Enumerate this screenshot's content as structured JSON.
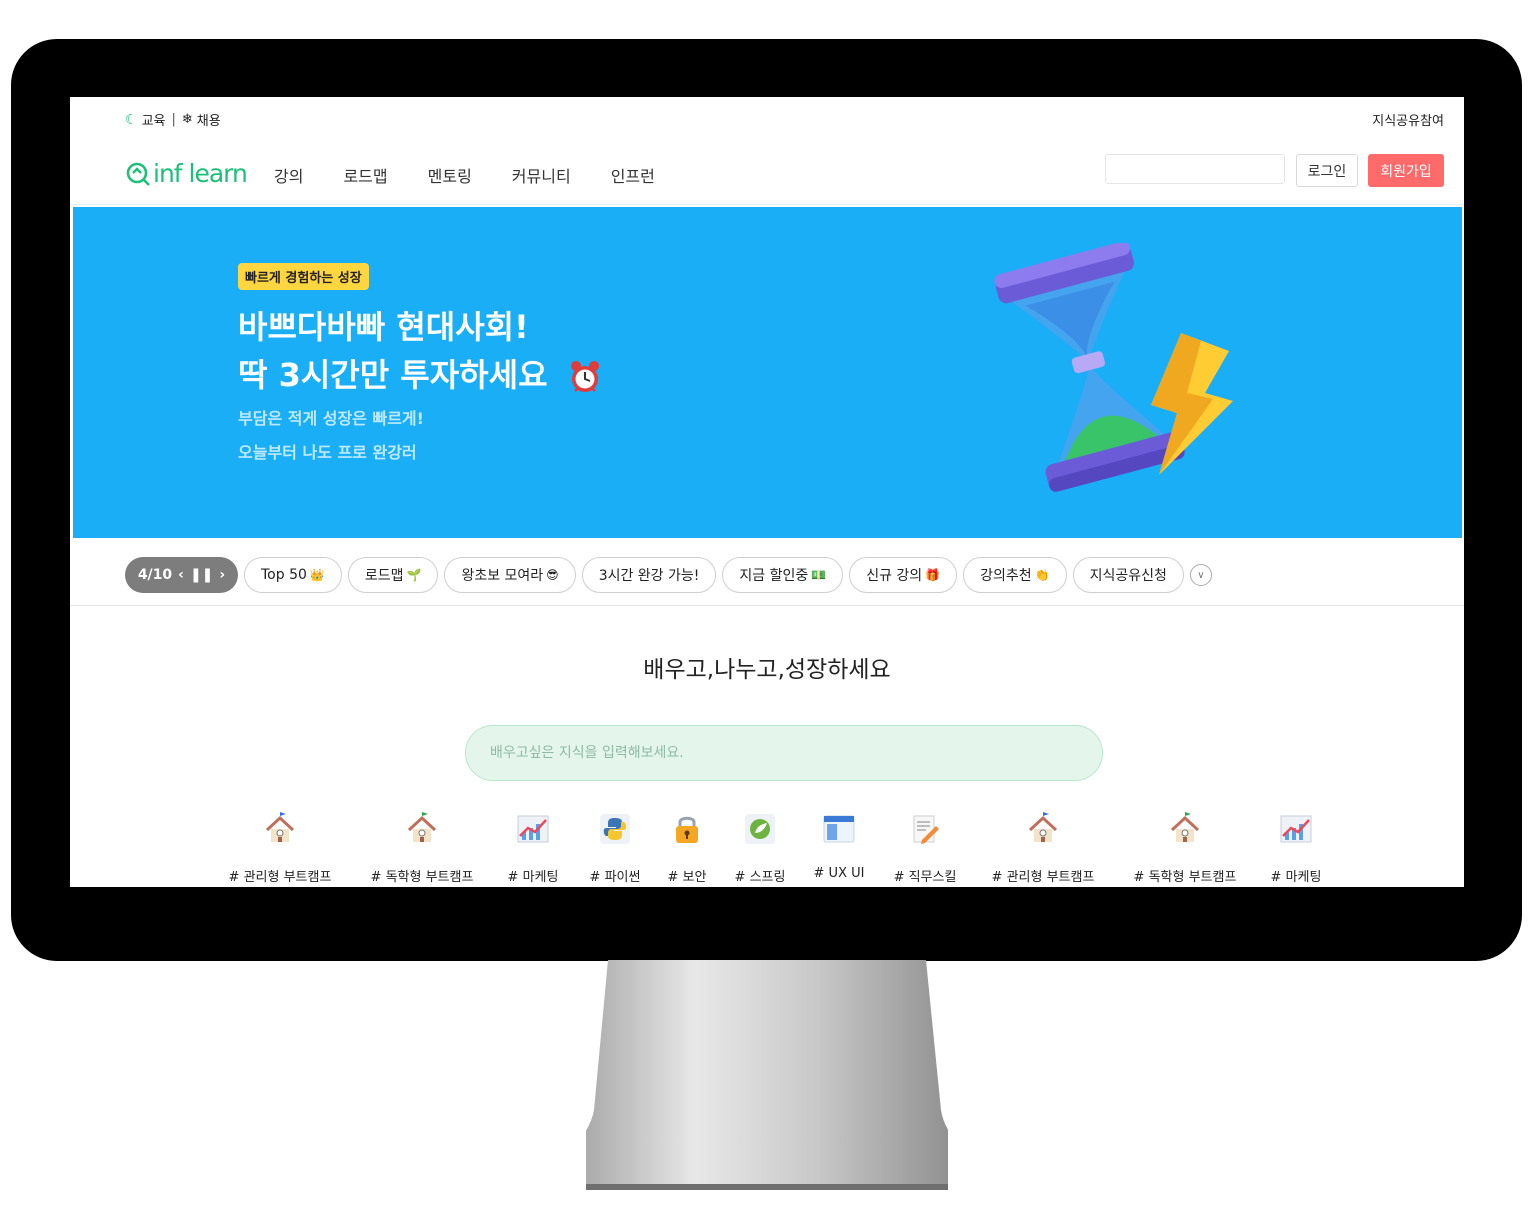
{
  "util": {
    "education": "교육",
    "separator": "|",
    "jobs": "채용",
    "share_join": "지식공유참여"
  },
  "nav": {
    "logo": "inf learn",
    "links": [
      "강의",
      "로드맵",
      "멘토링",
      "커뮤니티",
      "인프런"
    ],
    "login": "로그인",
    "signup": "회원가입",
    "search_value": ""
  },
  "banner": {
    "badge": "빠르게 경험하는 성장",
    "headline_1": "바쁘다바빠 현대사회!",
    "headline_2": "딱 3시간만 투자하세요",
    "sub_1": "부담은 적게 성장은 빠르게!",
    "sub_2": "오늘부터 나도 프로 완강러",
    "bg_color": "#19aef5"
  },
  "chips": {
    "pager": "4/10",
    "items": [
      {
        "label": "Top 50",
        "emoji": "👑"
      },
      {
        "label": "로드맵",
        "emoji": "🌱"
      },
      {
        "label": "왕초보 모여라",
        "emoji": "😎"
      },
      {
        "label": "3시간 완강 가능!",
        "emoji": ""
      },
      {
        "label": "지금 할인중",
        "emoji": "💵"
      },
      {
        "label": "신규 강의",
        "emoji": "🎁"
      },
      {
        "label": "강의추천",
        "emoji": "👏"
      },
      {
        "label": "지식공유신청",
        "emoji": ""
      }
    ]
  },
  "hero": {
    "tagline": "배우고,나누고,성장하세요",
    "search_placeholder": "배우고싶은 지식을 입력해보세요."
  },
  "topics": [
    {
      "label": "# 관리형 부트캠프",
      "icon": "school-icon"
    },
    {
      "label": "# 독학형 부트캠프",
      "icon": "school-icon"
    },
    {
      "label": "# 마케팅",
      "icon": "chart-icon"
    },
    {
      "label": "# 파이썬",
      "icon": "python-icon"
    },
    {
      "label": "# 보안",
      "icon": "lock-icon"
    },
    {
      "label": "# 스프링",
      "icon": "spring-icon"
    },
    {
      "label": "# UX UI",
      "icon": "window-icon"
    },
    {
      "label": "# 직무스킬",
      "icon": "memo-icon"
    },
    {
      "label": "# 관리형 부트캠프",
      "icon": "school-icon"
    },
    {
      "label": "# 독학형 부트캠프",
      "icon": "school-icon"
    },
    {
      "label": "# 마케팅",
      "icon": "chart-icon"
    }
  ],
  "colors": {
    "brand_green": "#1dc078",
    "signup_red": "#ff6b6b",
    "badge_yellow": "#ffd63f"
  }
}
